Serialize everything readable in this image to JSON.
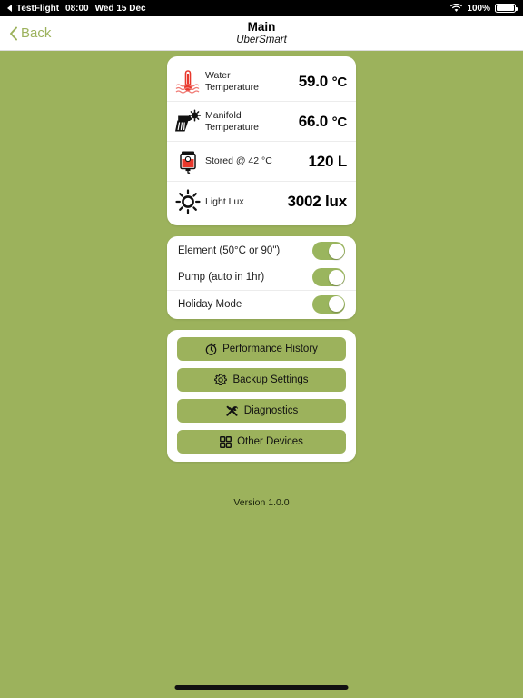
{
  "status_bar": {
    "back_app": "TestFlight",
    "time": "08:00",
    "date": "Wed 15 Dec",
    "battery_percent": "100%",
    "wifi_icon": "wifi-icon",
    "battery_icon": "battery-full-icon"
  },
  "nav": {
    "back_label": "Back",
    "back_icon": "chevron-left-icon",
    "title": "Main",
    "subtitle": "UberSmart"
  },
  "metrics": [
    {
      "icon": "water-thermometer-icon",
      "label_line1": "Water",
      "label_line2": "Temperature",
      "value": "59.0",
      "unit": "°C"
    },
    {
      "icon": "solar-manifold-icon",
      "label_line1": "Manifold",
      "label_line2": "Temperature",
      "value": "66.0",
      "unit": "°C"
    },
    {
      "icon": "storage-tank-icon",
      "label_line1": "Stored @ 42 °C",
      "label_line2": "",
      "value": "120",
      "unit": "L"
    },
    {
      "icon": "sun-icon",
      "label_line1": "Light Lux",
      "label_line2": "",
      "value": "3002",
      "unit": "lux"
    }
  ],
  "toggles": [
    {
      "label": "Element (50°C or 90\")",
      "state": "on"
    },
    {
      "label": "Pump (auto in 1hr)",
      "state": "on"
    },
    {
      "label": "Holiday Mode",
      "state": "on"
    }
  ],
  "actions": [
    {
      "label": "Performance History",
      "icon": "stopwatch-icon"
    },
    {
      "label": "Backup Settings",
      "icon": "gear-icon"
    },
    {
      "label": "Diagnostics",
      "icon": "tools-icon"
    },
    {
      "label": "Other Devices",
      "icon": "grid-icon"
    }
  ],
  "footer": {
    "version": "Version 1.0.0"
  },
  "colors": {
    "background": "#9cb25c",
    "accent": "#9cb25c",
    "toggle_on": "#9ab55e",
    "card": "#ffffff",
    "hot_red": "#e8382c"
  }
}
